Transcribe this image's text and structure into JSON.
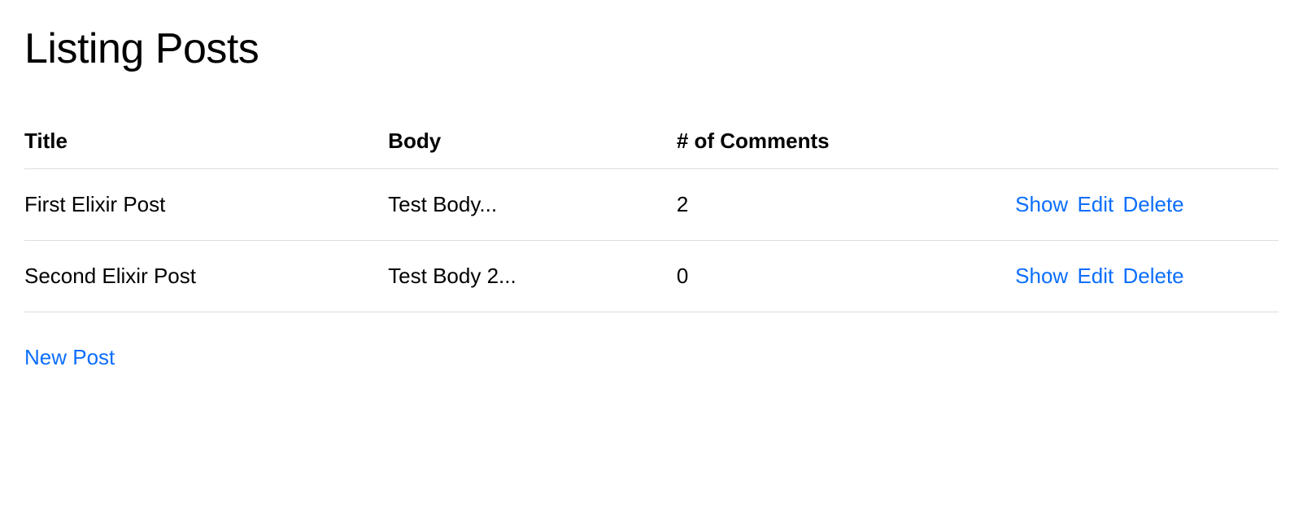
{
  "page": {
    "title": "Listing Posts"
  },
  "table": {
    "headers": {
      "title": "Title",
      "body": "Body",
      "comments": "# of Comments"
    },
    "rows": [
      {
        "title": "First Elixir Post",
        "body": "Test Body...",
        "comments": "2"
      },
      {
        "title": "Second Elixir Post",
        "body": "Test Body 2...",
        "comments": "0"
      }
    ],
    "actions": {
      "show": "Show",
      "edit": "Edit",
      "delete": "Delete"
    }
  },
  "links": {
    "new_post": "New Post"
  }
}
